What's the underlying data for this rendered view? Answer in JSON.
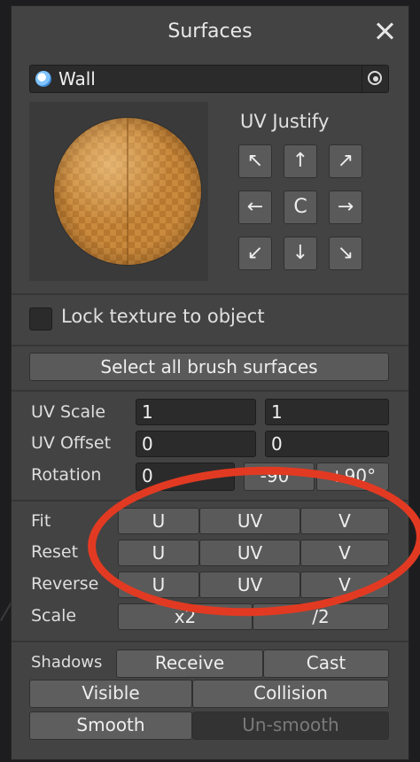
{
  "panel": {
    "title": "Surfaces"
  },
  "object_field": {
    "value": "Wall"
  },
  "uv_justify": {
    "title": "UV Justify",
    "buttons": [
      "↖",
      "↑",
      "↗",
      "←",
      "C",
      "→",
      "↙",
      "↓",
      "↘"
    ]
  },
  "lock_texture": {
    "label": "Lock texture to object",
    "checked": false
  },
  "select_all": {
    "label": "Select all brush surfaces"
  },
  "transform": {
    "uv_scale": {
      "label": "UV Scale",
      "x": "1",
      "y": "1"
    },
    "uv_offset": {
      "label": "UV Offset",
      "x": "0",
      "y": "0"
    },
    "rotation": {
      "label": "Rotation",
      "value": "0",
      "minus90": "-90°",
      "plus90": "+90°"
    }
  },
  "actions": {
    "fit": {
      "label": "Fit",
      "u": "U",
      "uv": "UV",
      "v": "V"
    },
    "reset": {
      "label": "Reset",
      "u": "U",
      "uv": "UV",
      "v": "V"
    },
    "reverse": {
      "label": "Reverse",
      "u": "U",
      "uv": "UV",
      "v": "V"
    },
    "scale": {
      "label": "Scale",
      "x2": "x2",
      "half": "/2"
    }
  },
  "shadows": {
    "label": "Shadows",
    "receive": "Receive",
    "cast": "Cast"
  },
  "flags": {
    "visible": "Visible",
    "collision": "Collision"
  },
  "smoothing": {
    "smooth": "Smooth",
    "unsmooth": "Un-smooth"
  },
  "colors": {
    "annotation": "#e23a22",
    "panel": "#434343",
    "button": "#5a5a5a"
  }
}
